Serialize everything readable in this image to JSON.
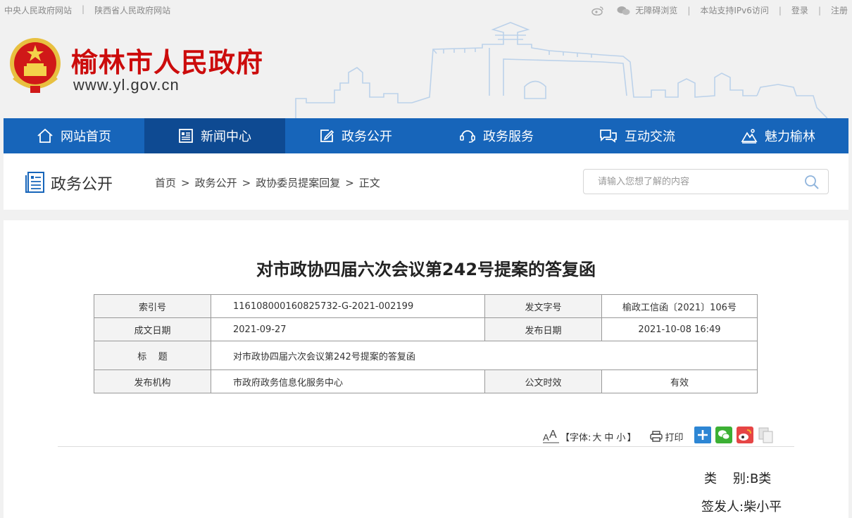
{
  "topbar": {
    "links_left": [
      "中央人民政府网站",
      "陕西省人民政府网站"
    ],
    "accessible": "无障碍浏览",
    "ipv6": "本站支持IPv6访问",
    "login": "登录",
    "register": "注册"
  },
  "header": {
    "title": "榆林市人民政府",
    "url": "www.yl.gov.cn"
  },
  "nav": {
    "items": [
      {
        "label": "网站首页",
        "icon": "home-icon"
      },
      {
        "label": "新闻中心",
        "icon": "news-icon",
        "active": true
      },
      {
        "label": "政务公开",
        "icon": "edit-icon"
      },
      {
        "label": "政务服务",
        "icon": "service-icon"
      },
      {
        "label": "互动交流",
        "icon": "chat-icon"
      },
      {
        "label": "魅力榆林",
        "icon": "mountain-icon"
      }
    ]
  },
  "section": {
    "title": "政务公开",
    "breadcrumb": [
      "首页",
      "政务公开",
      "政协委员提案回复",
      "正文"
    ],
    "search_placeholder": "请输入您想了解的内容"
  },
  "doc": {
    "title": "对市政协四届六次会议第242号提案的答复函",
    "meta": {
      "index_label": "索引号",
      "index_value": "116108000160825732-G-2021-002199",
      "docno_label": "发文字号",
      "docno_value": "榆政工信函〔2021〕106号",
      "date_label": "成文日期",
      "date_value": "2021-09-27",
      "pubdate_label": "发布日期",
      "pubdate_value": "2021-10-08 16:49",
      "subject_label": "标    题",
      "subject_value": "对市政协四届六次会议第242号提案的答复函",
      "org_label": "发布机构",
      "org_value": "市政府政务信息化服务中心",
      "validity_label": "公文时效",
      "validity_value": "有效"
    },
    "tools": {
      "font_prefix": "【字体:",
      "font_large": "大",
      "font_medium": "中",
      "font_small": "小",
      "font_suffix": "】",
      "print": "打印"
    },
    "category": "类    别:B类",
    "signer": "签发人:柴小平"
  },
  "colors": {
    "brand_red": "#cc0c0c",
    "nav_blue": "#1765ba",
    "nav_active": "#0e4a92"
  }
}
